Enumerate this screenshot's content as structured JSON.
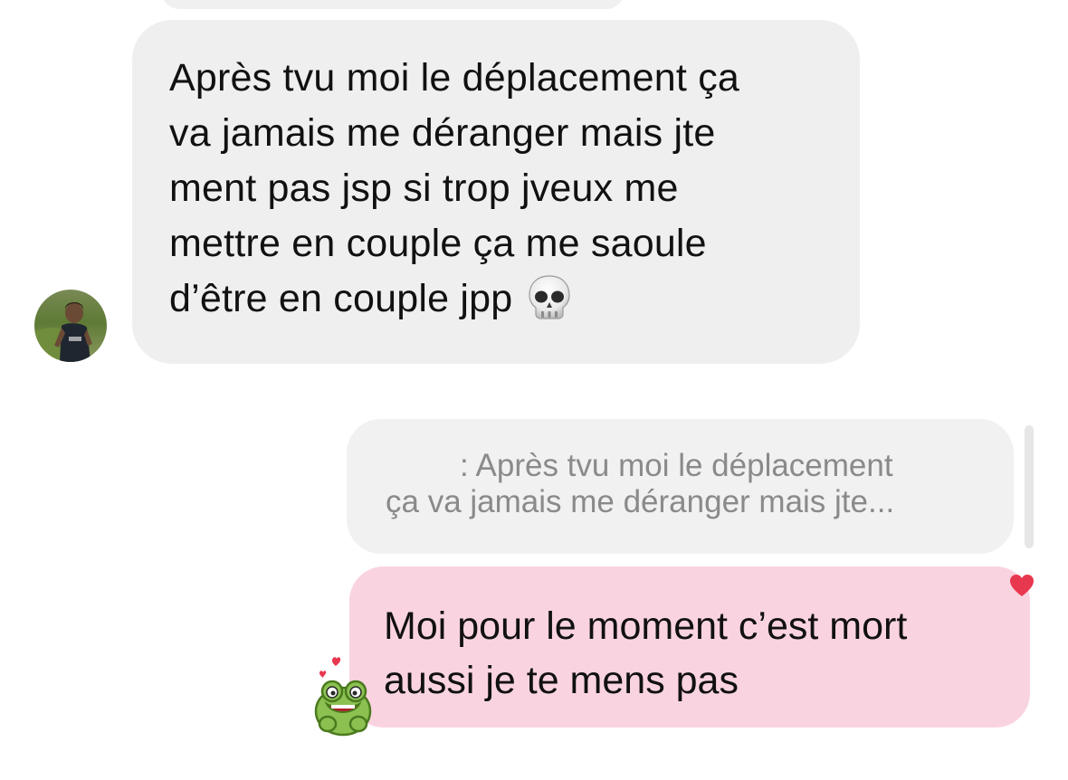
{
  "conversation": {
    "incoming_message": {
      "lines": [
        "Après tvu moi le déplacement ça",
        "va jamais me déranger mais jte",
        "ment pas jsp si trop jveux me",
        "mettre en couple ça me saoule",
        "d’être en couple jpp"
      ],
      "emoji": "skull-emoji",
      "sender_avatar": "profile-photo"
    },
    "reply_preview": {
      "line1": ": Après tvu moi le déplacement",
      "line2": "ça va jamais me déranger mais jte..."
    },
    "outgoing_message": {
      "lines": [
        "Moi pour le moment c’est mort",
        "aussi je te mens pas"
      ],
      "reaction_icon": "heart-icon",
      "sticker": "frog-sticker"
    }
  },
  "colors": {
    "incoming_bubble": "#efefef",
    "reply_preview": "#f1f1f1",
    "outgoing_bubble": "#fad3e1",
    "heart": "#e8384f"
  }
}
